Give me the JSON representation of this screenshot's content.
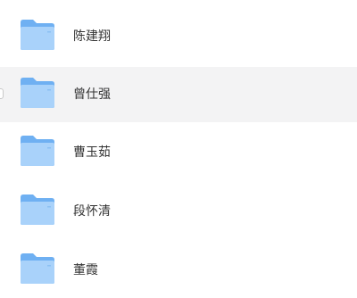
{
  "colors": {
    "selected_row_bg": "#f3f3f4",
    "folder_back": "#6fb0f2",
    "folder_front": "#a9d2fa",
    "text": "#333333"
  },
  "folders": [
    {
      "name": "陈建翔",
      "icon": "folder-icon",
      "selected": false
    },
    {
      "name": "曾仕强",
      "icon": "folder-icon",
      "selected": true
    },
    {
      "name": "曹玉茹",
      "icon": "folder-icon",
      "selected": false
    },
    {
      "name": "段怀清",
      "icon": "folder-icon",
      "selected": false
    },
    {
      "name": "董霞",
      "icon": "folder-icon",
      "selected": false
    }
  ]
}
